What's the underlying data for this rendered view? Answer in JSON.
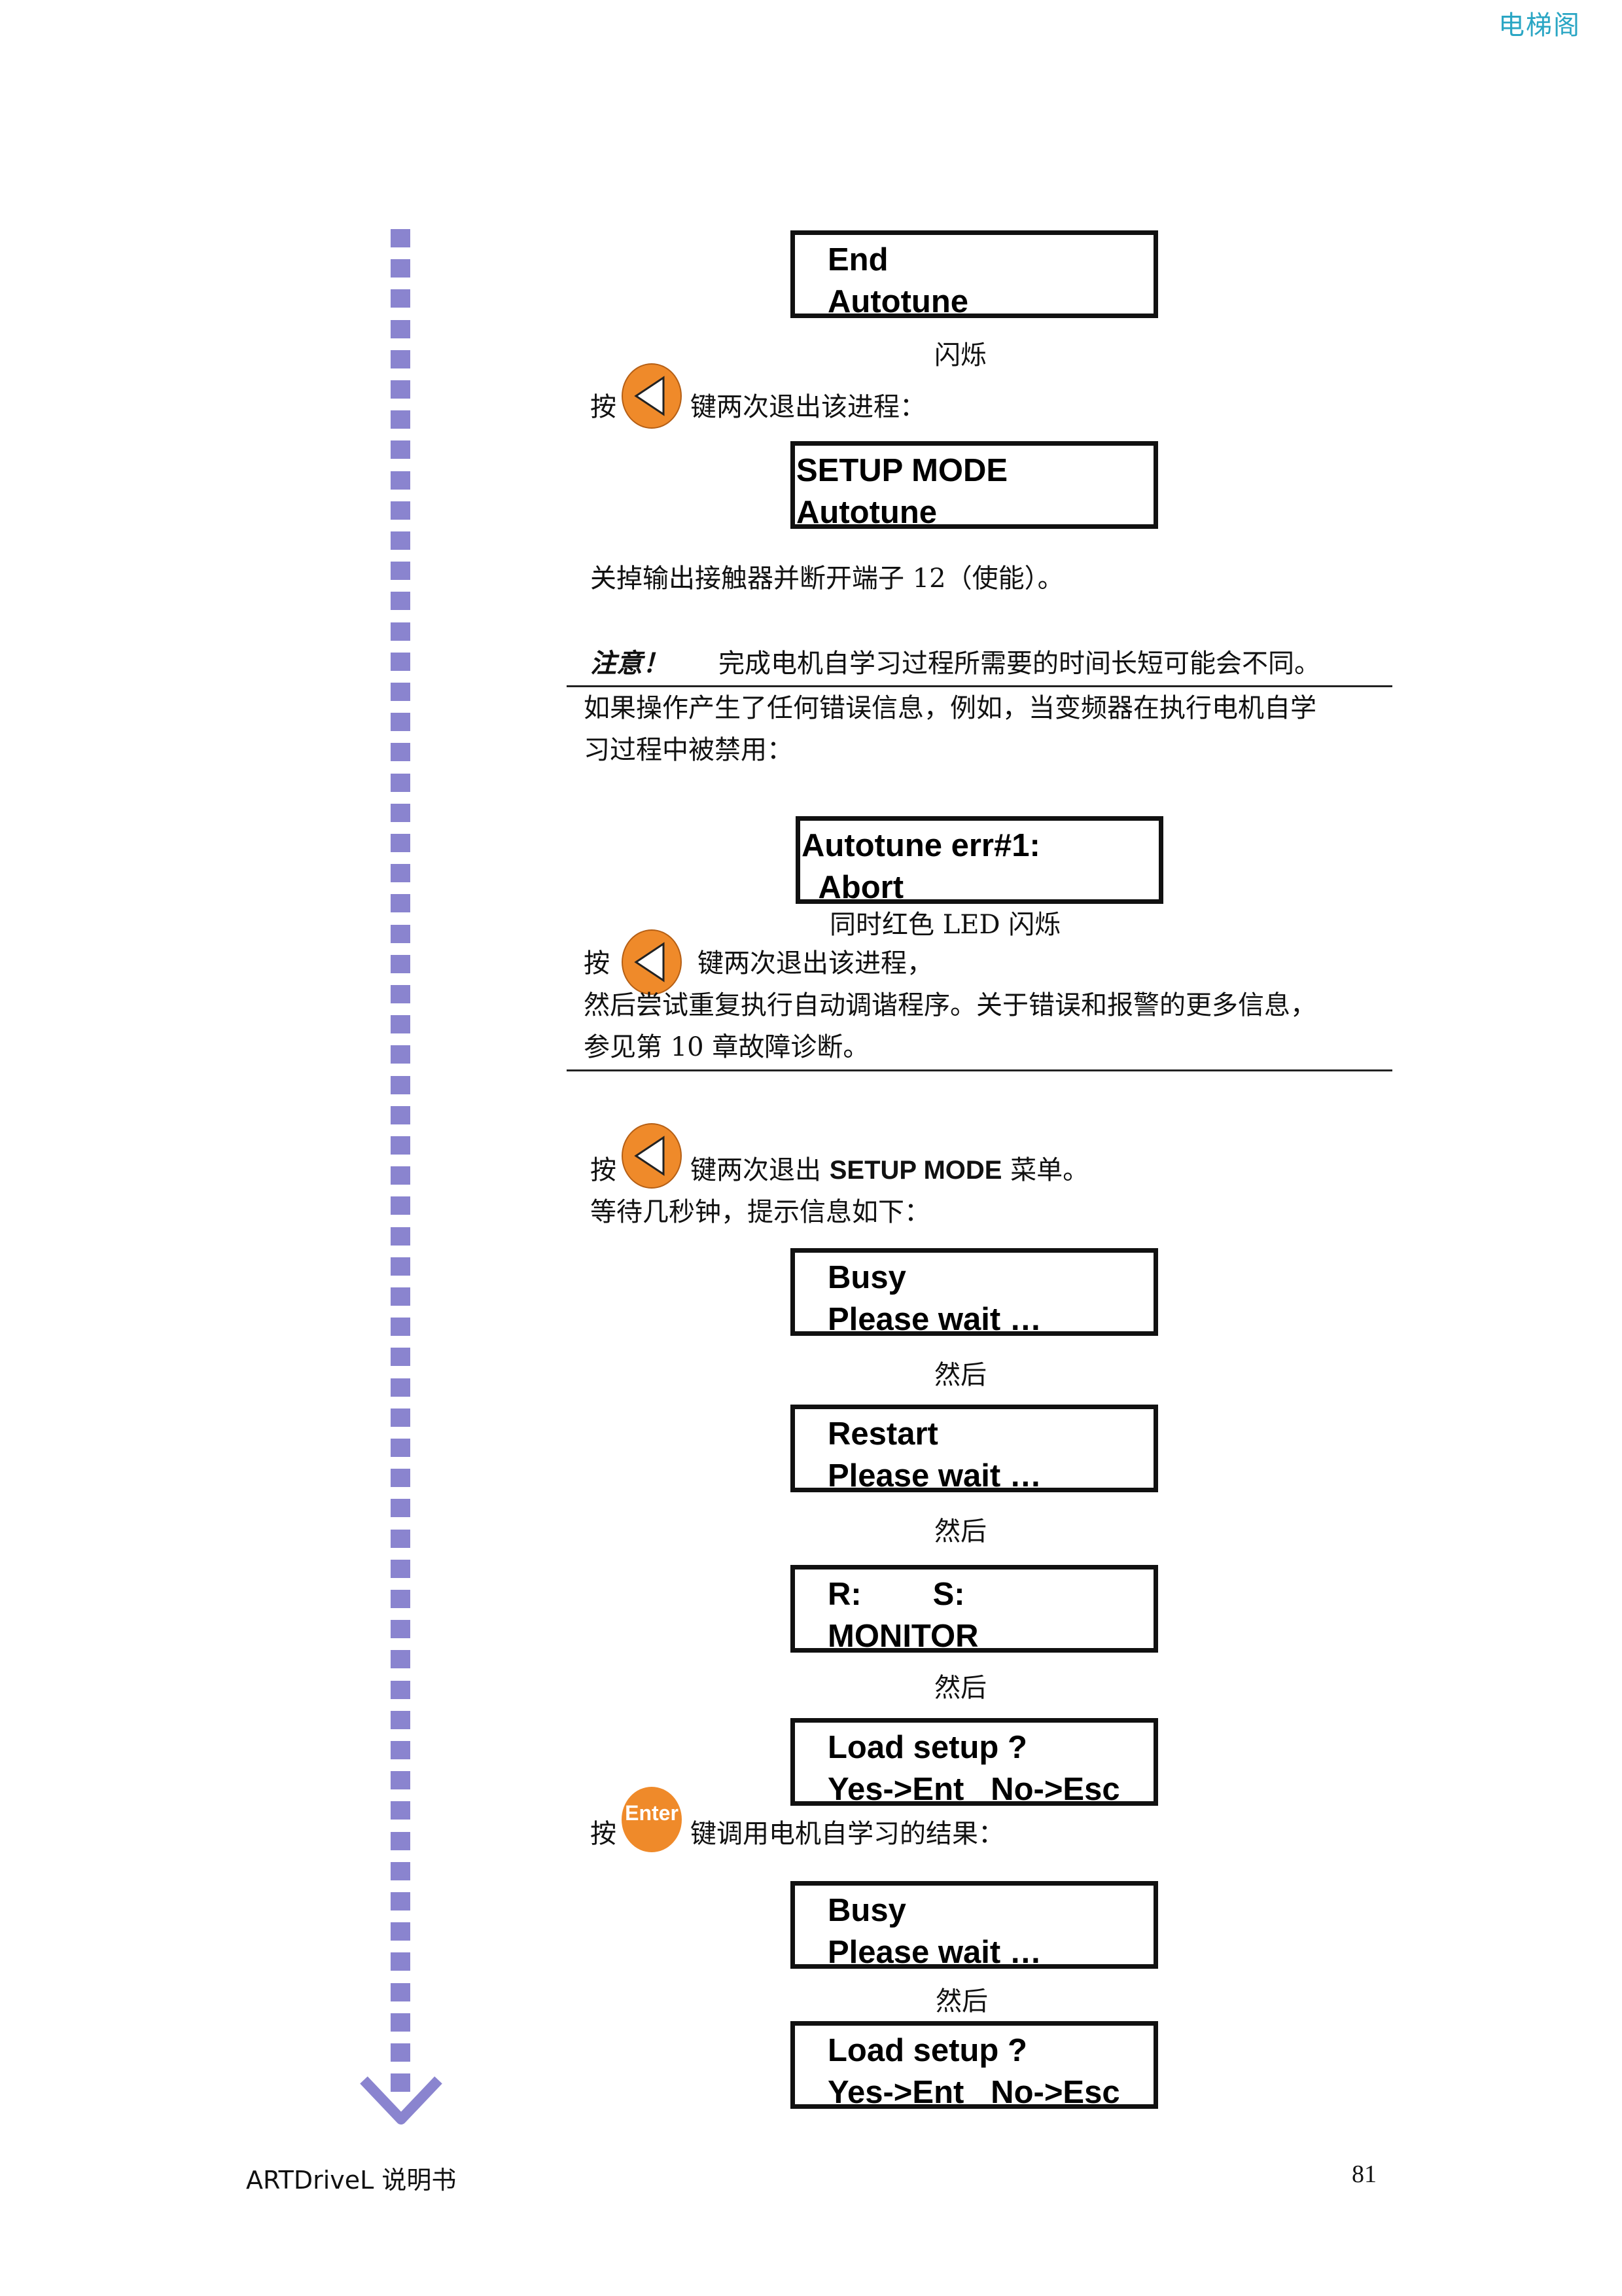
{
  "header": {
    "brand": "电梯阁"
  },
  "steps": {
    "lcd_end_autotune": {
      "line1": "End",
      "line2": "Autotune"
    },
    "caption_blink": "闪烁",
    "press_left_1": {
      "prefix": "按",
      "suffix": "键两次退出该进程："
    },
    "lcd_setup_mode": {
      "line1": "SETUP MODE",
      "line2": "Autotune"
    },
    "instruction_contactor": "关掉输出接触器并断开端子 12（使能）。",
    "note": {
      "label": "注意！",
      "text": "完成电机自学习过程所需要的时间长短可能会不同。",
      "body_line1": "如果操作产生了任何错误信息，例如，当变频器在执行电机自学",
      "body_line2": "习过程中被禁用："
    },
    "lcd_error": {
      "line1": "Autotune err#1:",
      "line2": "  Abort"
    },
    "caption_red_led": "同时红色 LED 闪烁",
    "press_left_2": {
      "prefix": "按",
      "suffix": "键两次退出该进程，"
    },
    "retry_line1": "然后尝试重复执行自动调谐程序。关于错误和报警的更多信息，",
    "retry_line2": "参见第 10 章故障诊断。",
    "press_left_3": {
      "prefix": "按",
      "suffix_pre": "键两次退出 ",
      "suffix_bold": "SETUP MODE",
      "suffix_post": " 菜单。"
    },
    "wait_text": "等待几秒钟，提示信息如下：",
    "lcd_busy_1": {
      "line1": "Busy",
      "line2": "Please wait …"
    },
    "then_1": "然后",
    "lcd_restart": {
      "line1": "Restart",
      "line2": "Please wait …"
    },
    "then_2": "然后",
    "lcd_monitor": {
      "line1": "R:        S:",
      "line2": "MONITOR"
    },
    "then_3": "然后",
    "lcd_load_1": {
      "line1": "Load setup ?",
      "line2": "Yes->Ent   No->Esc"
    },
    "press_enter": {
      "prefix": "按",
      "key_label": "Enter",
      "suffix": "键调用电机自学习的结果："
    },
    "lcd_busy_2": {
      "line1": "Busy",
      "line2": "Please wait …"
    },
    "then_4": "然后",
    "lcd_load_2": {
      "line1": "Load setup ?",
      "line2": "Yes->Ent   No->Esc"
    }
  },
  "icons": {
    "left_key": "left-arrow-key-icon",
    "enter_key": "enter-key-icon",
    "flow_arrow": "dashed-down-arrow-icon"
  },
  "colors": {
    "key_orange": "#ef8a2a",
    "flow_purple": "#8a84cf",
    "brand_teal": "#2aa6c4"
  },
  "footer": {
    "manual_title": "ARTDriveL 说明书",
    "page_number": "81"
  }
}
